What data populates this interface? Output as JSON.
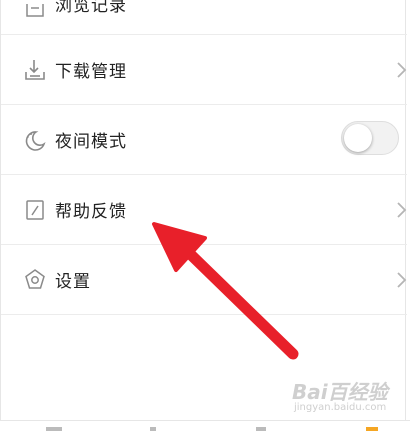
{
  "menu": {
    "items": [
      {
        "label": "浏览记录",
        "icon": "history-icon"
      },
      {
        "label": "下载管理",
        "icon": "download-icon"
      },
      {
        "label": "夜间模式",
        "icon": "moon-icon"
      },
      {
        "label": "帮助反馈",
        "icon": "edit-icon"
      },
      {
        "label": "设置",
        "icon": "settings-icon"
      }
    ],
    "night_mode_on": false
  },
  "watermark": {
    "logo": "Bai百经验",
    "sub": "jingyan.baidu.com"
  },
  "colors": {
    "arrow": "#e8202a",
    "icon": "#8a8a8a",
    "text": "#222222",
    "divider": "#ececec"
  }
}
